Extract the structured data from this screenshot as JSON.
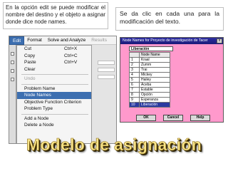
{
  "note1": "En la opción edit se puede modificar el nombre del destino y el objeto a asignar donde dice node names.",
  "note2": "Se da clic en cada una para la modificación del texto.",
  "menubar": {
    "items": [
      "Edit",
      "Format",
      "Solve and Analyze",
      "Results"
    ],
    "active": "Edit"
  },
  "edit_menu": {
    "cut": {
      "label": "Cut",
      "shortcut": "Ctrl+X"
    },
    "copy": {
      "label": "Copy",
      "shortcut": "Ctrl+C"
    },
    "paste": {
      "label": "Paste",
      "shortcut": "Ctrl+V"
    },
    "clear": "Clear",
    "undo": "Undo",
    "problem_name": "Problem Name",
    "node_names": "Node Names",
    "objective": "Objective Function Criterion",
    "problem_type": "Problem Type",
    "add_node": "Add a Node",
    "delete_node": "Delete a Node"
  },
  "dialog": {
    "title": "Node Names for Proyecto de investigación de Tacer",
    "close_glyph": "x",
    "current": "Liberación",
    "header_node_name": "Node Name",
    "rows": [
      {
        "n": "1",
        "name": "Kraal"
      },
      {
        "n": "2",
        "name": "Zumm"
      },
      {
        "n": "3",
        "name": "Trai"
      },
      {
        "n": "4",
        "name": "Mickey"
      },
      {
        "n": "5",
        "name": "Hailey"
      },
      {
        "n": "6",
        "name": "Aceba"
      },
      {
        "n": "7",
        "name": "Estable"
      },
      {
        "n": "8",
        "name": "Opción"
      },
      {
        "n": "9",
        "name": "Esperanza"
      },
      {
        "n": "10",
        "name": "Liberación"
      }
    ],
    "selected_row": "10",
    "ok": "OK",
    "cancel": "Cancel",
    "help": "Help"
  },
  "title": "Modelo de asignación"
}
